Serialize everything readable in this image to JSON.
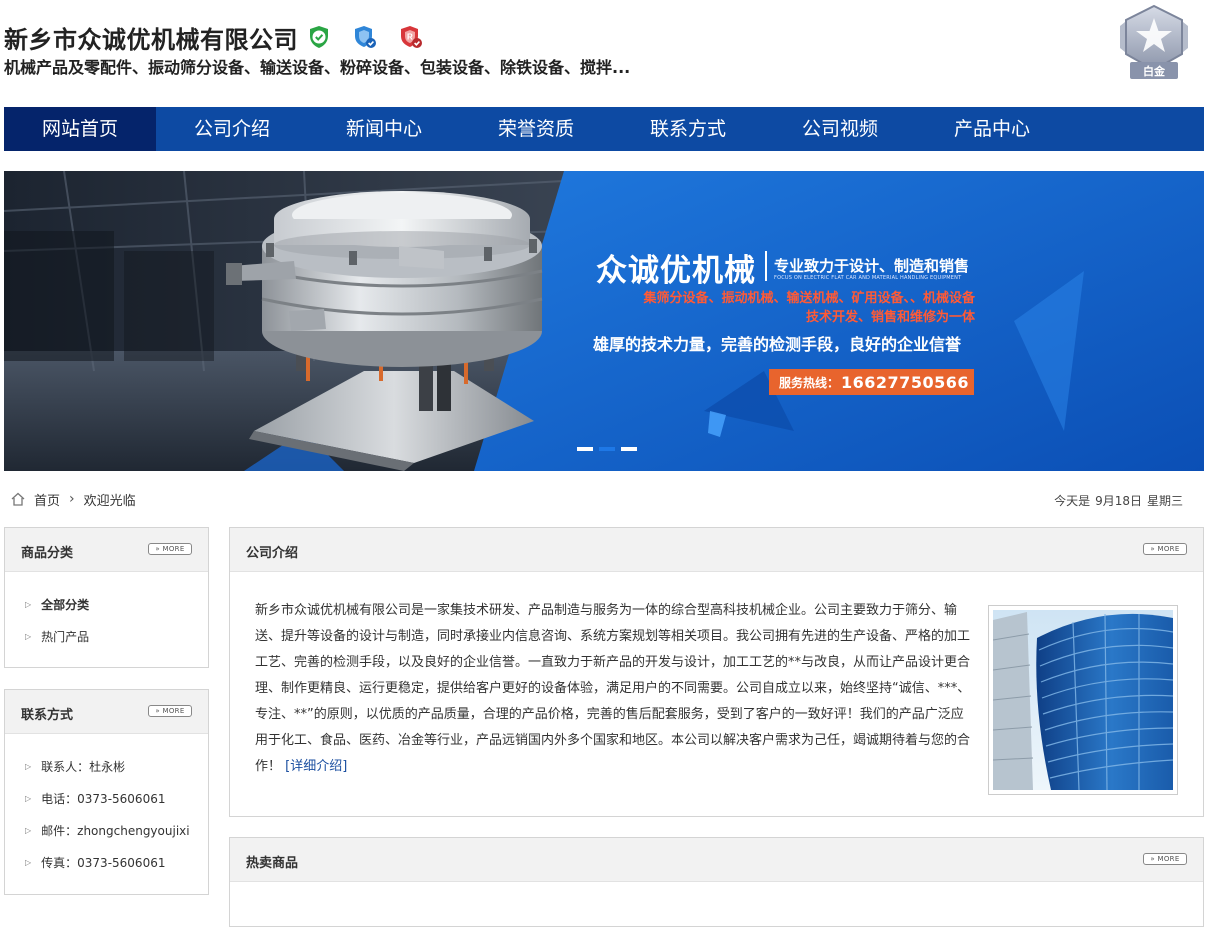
{
  "header": {
    "company_name": "新乡市众诚优机械有限公司",
    "subtitle": "机械产品及零配件、振动筛分设备、输送设备、粉碎设备、包装设备、除铁设备、搅拌...",
    "badges": [
      "verified-shield-icon",
      "guarantee-shield-icon",
      "registered-shield-icon"
    ],
    "medal_label": "白金"
  },
  "nav": {
    "items": [
      "网站首页",
      "公司介绍",
      "新闻中心",
      "荣誉资质",
      "联系方式",
      "公司视频",
      "产品中心"
    ],
    "active_index": 0,
    "color": "#0d4aa3",
    "active_color": "#05246b"
  },
  "banner": {
    "brand": "众诚优机械",
    "tagline": "专业致力于设计、制造和销售",
    "tagline_en": "FOCUS ON ELECTRIC FLAT CAR AND MATERIAL HANDLING EQUIPMENT",
    "line1": "集筛分设备、振动机械、输送机械、矿用设备、、机械设备",
    "line2": "技术开发、销售和维修为一体",
    "slogan": "雄厚的技术力量，完善的检测手段，良好的企业信誉",
    "hotline_label": "服务热线：",
    "hotline_number": "16627750566",
    "slides_active": 1,
    "slides_count": 3
  },
  "breadcrumb": {
    "home": "首页",
    "current": "欢迎光临"
  },
  "date": {
    "prefix": "今天是",
    "day": "9月18日",
    "weekday": "星期三"
  },
  "sidebar": {
    "categories": {
      "title": "商品分类",
      "more": "» MORE",
      "items": [
        "全部分类",
        "热门产品"
      ]
    },
    "contact": {
      "title": "联系方式",
      "more": "» MORE",
      "items": [
        "联系人：杜永彬",
        "电话：0373-5606061",
        "邮件：zhongchengyoujixi",
        "传真：0373-5606061"
      ]
    }
  },
  "intro": {
    "title": "公司介绍",
    "more": "» MORE",
    "text": "新乡市众诚优机械有限公司是一家集技术研发、产品制造与服务为一体的综合型高科技机械企业。公司主要致力于筛分、输送、提升等设备的设计与制造，同时承接业内信息咨询、系统方案规划等相关项目。我公司拥有先进的生产设备、严格的加工工艺、完善的检测手段，以及良好的企业信誉。一直致力于新产品的开发与设计，加工工艺的**与改良，从而让产品设计更合理、制作更精良、运行更稳定，提供给客户更好的设备体验，满足用户的不同需要。公司自成立以来，始终坚持“诚信、***、专注、**”的原则，以优质的产品质量，合理的产品价格，完善的售后配套服务，受到了客户的一致好评！我们的产品广泛应用于化工、食品、医药、冶金等行业，产品远销国内外多个国家和地区。本公司以解决客户需求为己任，竭诚期待着与您的合作！",
    "detail_link": "[详细介绍]"
  },
  "hot": {
    "title": "热卖商品",
    "more": "» MORE"
  }
}
